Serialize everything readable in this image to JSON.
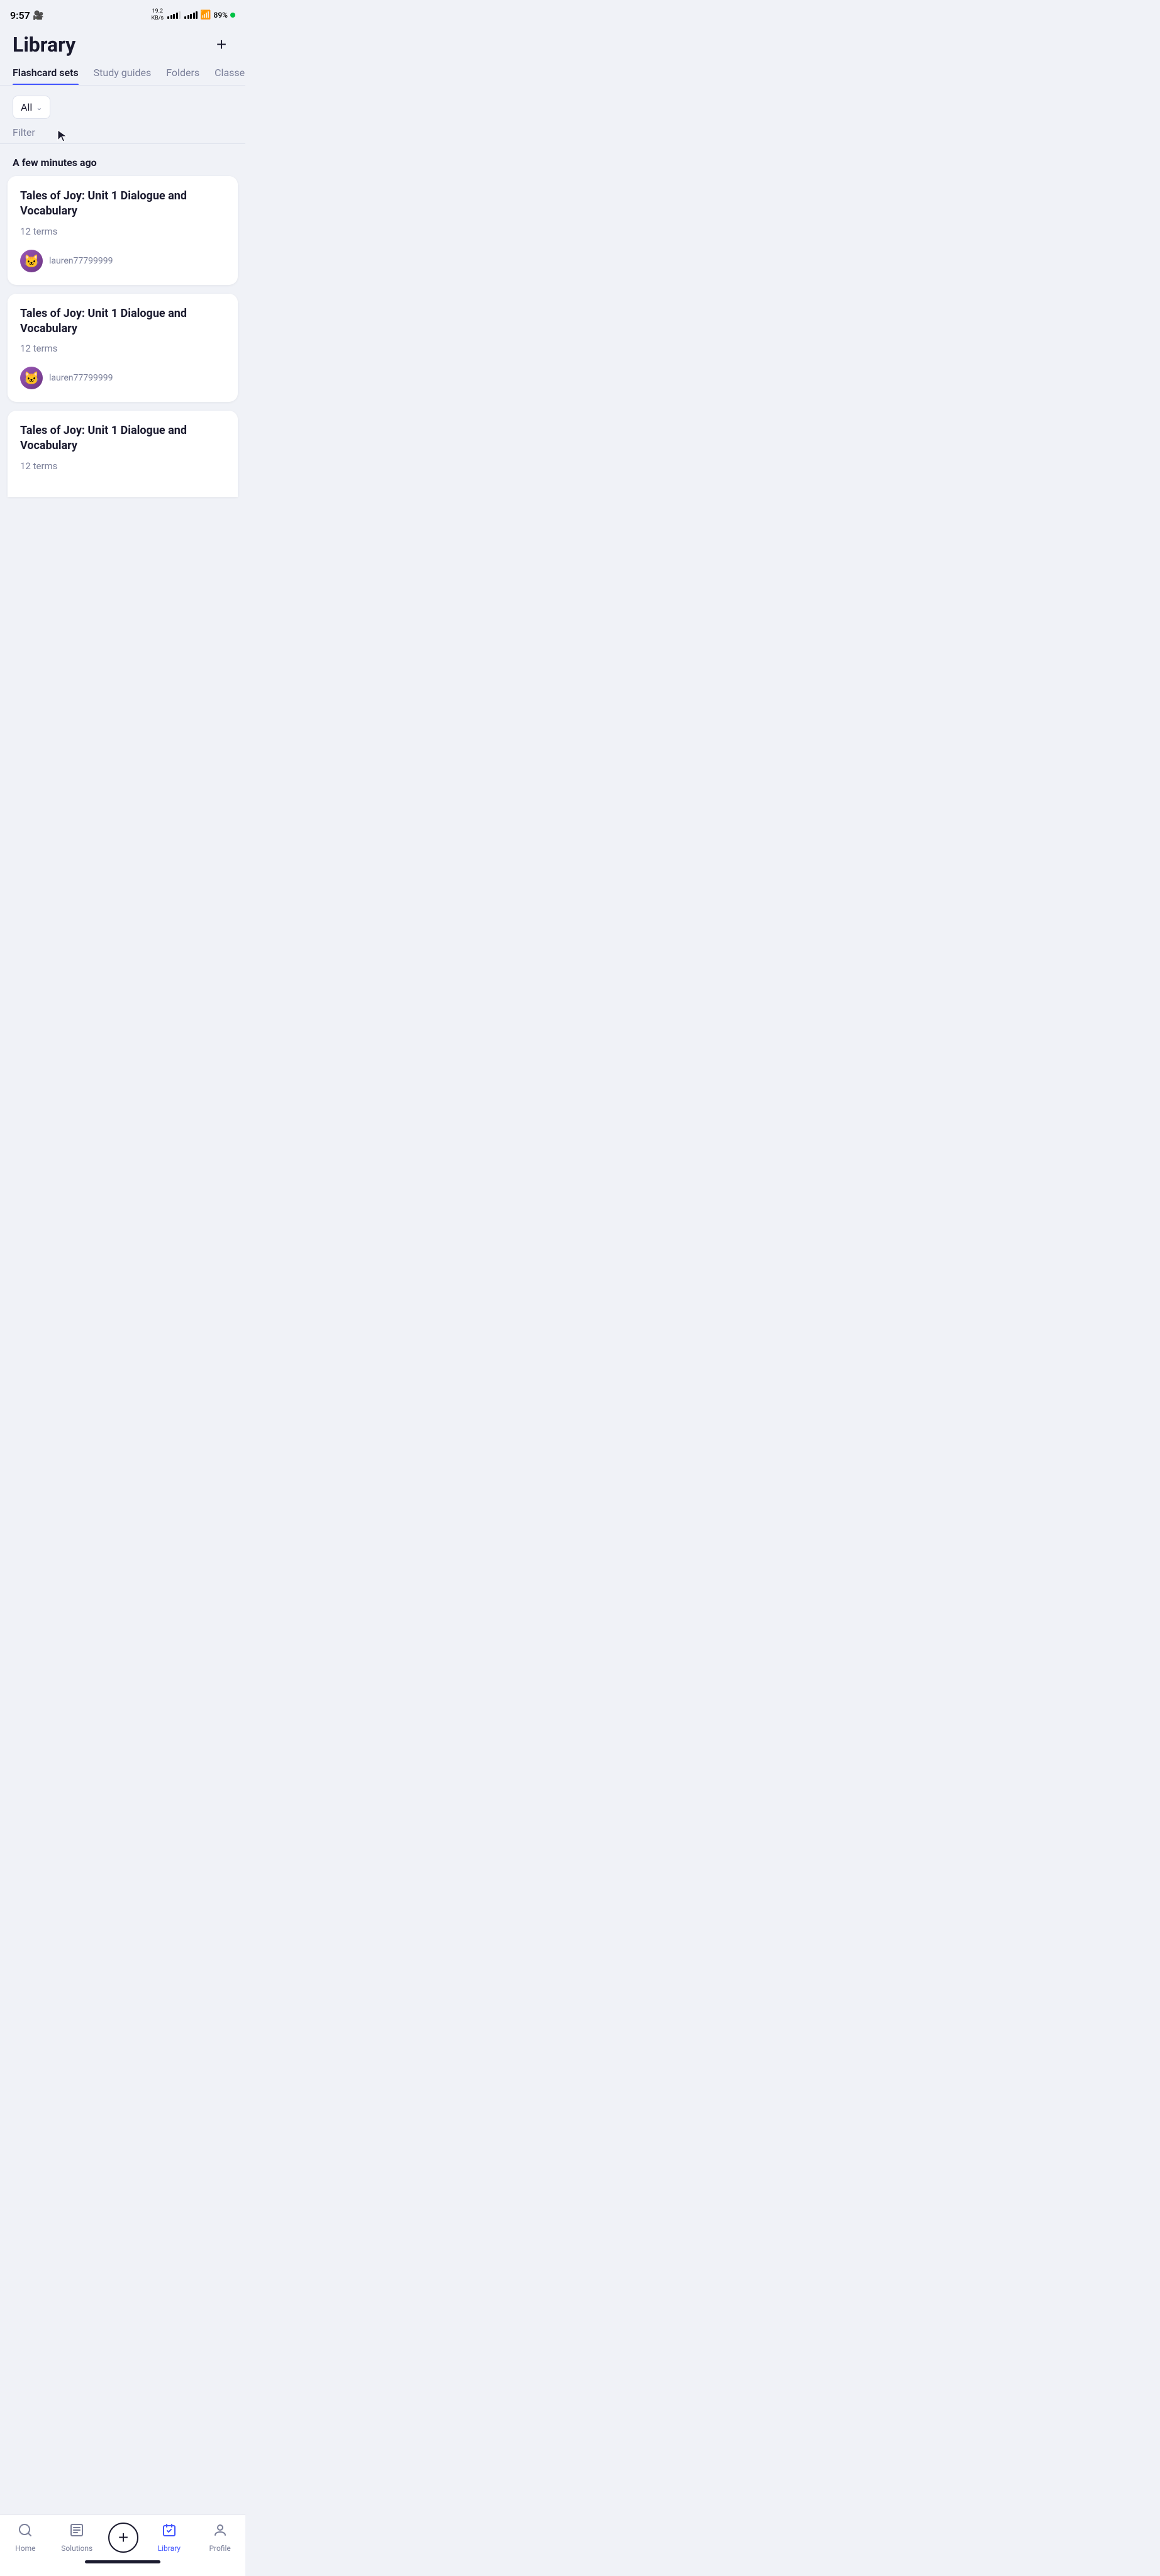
{
  "statusBar": {
    "time": "9:57",
    "dataSpeed": "19.2\nKB/s",
    "batteryPercent": "89%"
  },
  "header": {
    "title": "Library",
    "addButton": "+"
  },
  "tabs": [
    {
      "label": "Flashcard sets",
      "active": true
    },
    {
      "label": "Study guides",
      "active": false
    },
    {
      "label": "Folders",
      "active": false
    },
    {
      "label": "Classes",
      "active": false
    }
  ],
  "filter": {
    "dropdownLabel": "All",
    "filterText": "Filter"
  },
  "timeSection": {
    "label": "A few minutes ago"
  },
  "cards": [
    {
      "title": "Tales of Joy: Unit 1 Dialogue and Vocabulary",
      "terms": "12 terms",
      "author": "lauren77799999"
    },
    {
      "title": "Tales of Joy: Unit 1 Dialogue and Vocabulary",
      "terms": "12 terms",
      "author": "lauren77799999"
    },
    {
      "title": "Tales of Joy: Unit 1 Dialogue and Vocabulary",
      "terms": "12 terms",
      "author": ""
    }
  ],
  "bottomNav": [
    {
      "label": "Home",
      "icon": "home",
      "active": false
    },
    {
      "label": "Solutions",
      "icon": "solutions",
      "active": false
    },
    {
      "label": "",
      "icon": "add",
      "active": false
    },
    {
      "label": "Library",
      "icon": "library",
      "active": true
    },
    {
      "label": "Profile",
      "icon": "profile",
      "active": false
    }
  ]
}
